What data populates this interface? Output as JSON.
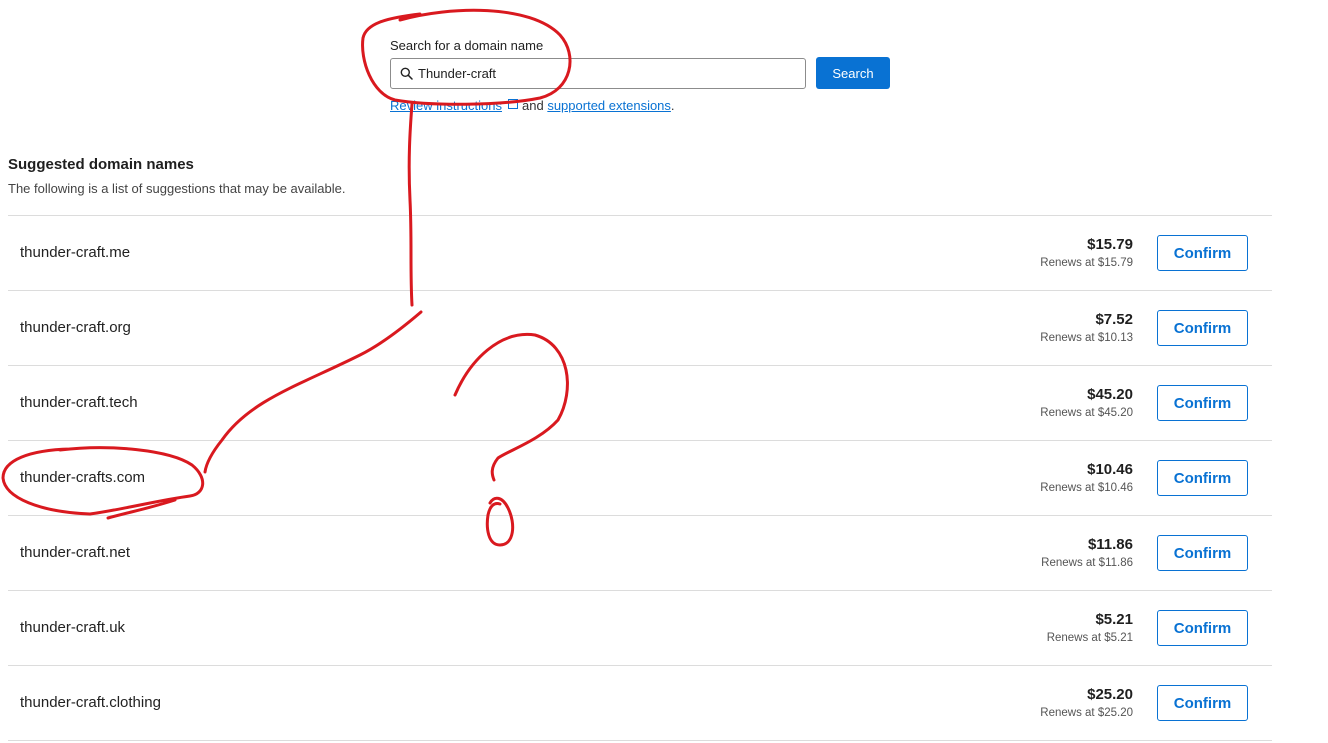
{
  "search": {
    "label": "Search for a domain name",
    "value": "Thunder-craft",
    "button_label": "Search",
    "help_link1": "Review instructions",
    "help_connector": "and",
    "help_link2": "supported extensions",
    "help_end": "."
  },
  "suggestions": {
    "title": "Suggested domain names",
    "description": "The following is a list of suggestions that may be available.",
    "confirm_label": "Confirm",
    "rows": [
      {
        "domain": "thunder-craft.me",
        "price": "$15.79",
        "renew": "Renews at $15.79"
      },
      {
        "domain": "thunder-craft.org",
        "price": "$7.52",
        "renew": "Renews at $10.13"
      },
      {
        "domain": "thunder-craft.tech",
        "price": "$45.20",
        "renew": "Renews at $45.20"
      },
      {
        "domain": "thunder-crafts.com",
        "price": "$10.46",
        "renew": "Renews at $10.46"
      },
      {
        "domain": "thunder-craft.net",
        "price": "$11.86",
        "renew": "Renews at $11.86"
      },
      {
        "domain": "thunder-craft.uk",
        "price": "$5.21",
        "renew": "Renews at $5.21"
      },
      {
        "domain": "thunder-craft.clothing",
        "price": "$25.20",
        "renew": "Renews at $25.20"
      }
    ]
  },
  "colors": {
    "accent": "#0972d3",
    "annotation": "#d9191f"
  }
}
